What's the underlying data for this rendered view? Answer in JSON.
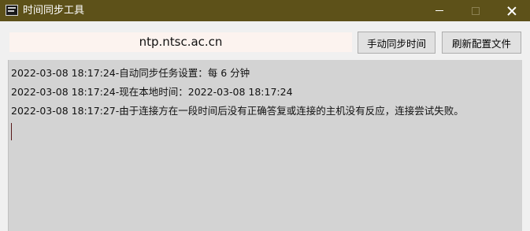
{
  "window": {
    "title": "时间同步工具",
    "titlebar_color": "#5d5119",
    "icons": {
      "app": "terminal-app-icon",
      "minimize": "minimize-icon",
      "maximize": "maximize-icon",
      "close": "close-icon"
    }
  },
  "toolbar": {
    "server_value": "ntp.ntsc.ac.cn",
    "sync_button_label": "手动同步时间",
    "refresh_button_label": "刷新配置文件"
  },
  "log": {
    "lines": [
      "2022-03-08 18:17:24-自动同步任务设置：每 6 分钟",
      "2022-03-08 18:17:24-现在本地时间：2022-03-08 18:17:24",
      "2022-03-08 18:17:27-由于连接方在一段时间后没有正确答复或连接的主机没有反应，连接尝试失败。"
    ]
  }
}
